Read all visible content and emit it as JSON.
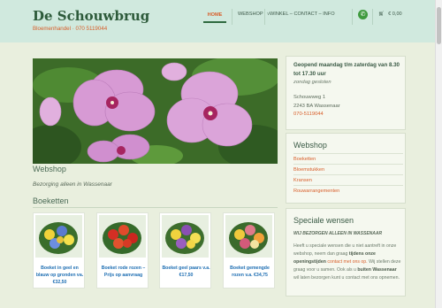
{
  "brand": {
    "name": "De Schouwbrug",
    "tagline": "Bloemenhandel · 070 5119044"
  },
  "nav": {
    "home": "HOME",
    "webshop": "WEBSHOP",
    "winkel": "WINKEL – CONTACT – INFO",
    "cart": "€ 0,00"
  },
  "main": {
    "section_title": "Webshop",
    "section_sub": "Bezorging alleen in Wassenaar",
    "category_title": "Boeketten",
    "products": [
      {
        "name": "Boeket in geel en blauw op gronden va. €32,50"
      },
      {
        "name": "Boeket rode rozen – Prijs op aanvraag"
      },
      {
        "name": "Boeket geel paars v.a. €17,50"
      },
      {
        "name": "Boeket gemengde rozen v.a. €34,75"
      }
    ]
  },
  "sidebar": {
    "hours": {
      "heading": "Geopend maandag t/m zaterdag van 8.30 tot 17.30 uur",
      "closed": "zondag gesloten",
      "address_line1": "Schouwweg 1",
      "address_line2": "2243 BA Wassenaar",
      "phone": "070-5119044"
    },
    "webshop": {
      "title": "Webshop",
      "items": [
        "Boeketten",
        "Bloemstukken",
        "Kransen",
        "Rouwarrangementen"
      ]
    },
    "special": {
      "title": "Speciale wensen",
      "subtitle": "WIJ BEZORGEN ALLEEN IN WASSENAAR",
      "p1": "Heeft u speciale wensen die u niet aantreft in onze webshop, neem dan graag",
      "p1_bold": "tijdens onze openingstijden",
      "p1_link": "contact met ons op.",
      "p1_end": "Wij stellen deze graag voor u samen. Ook als u",
      "p2_bold": "buiten Wassenaar",
      "p2_end": "wil laten bezorgen kunt u contact met ons opnemen."
    }
  },
  "colors": {
    "header_bg": "#d0e9de",
    "page_bg": "#e9efde",
    "accent_orange": "#d85e2a",
    "link_blue": "#1f6fb3"
  }
}
